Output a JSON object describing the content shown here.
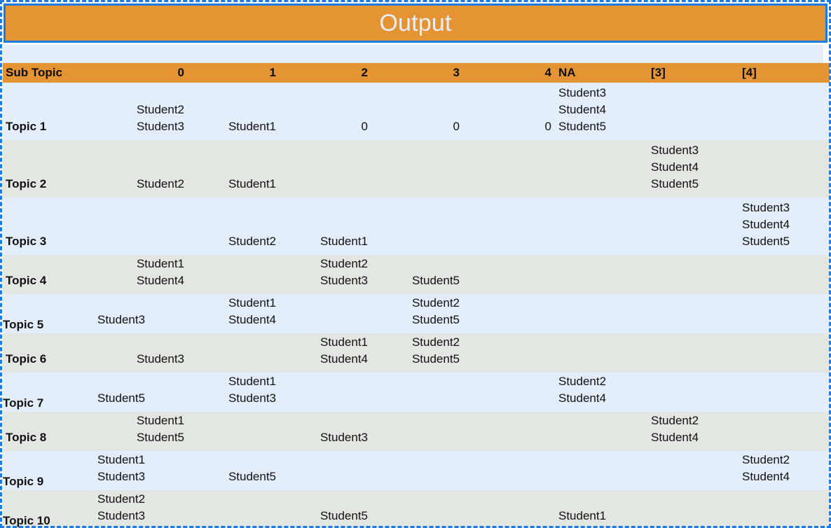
{
  "title": "Output",
  "colors": {
    "header_orange": "#e59434",
    "frame_blue": "#1b7ae4",
    "row_blue": "#e4eefa",
    "row_green": "#e3e7e1",
    "title_text": "#e8eef8"
  },
  "table": {
    "columns": [
      {
        "label": "Sub Topic",
        "align": "left",
        "key": "sub"
      },
      {
        "label": "0",
        "align": "right",
        "key": "c0"
      },
      {
        "label": "1",
        "align": "right",
        "key": "c1"
      },
      {
        "label": "2",
        "align": "right",
        "key": "c2"
      },
      {
        "label": "3",
        "align": "right",
        "key": "c3"
      },
      {
        "label": "4",
        "align": "right",
        "key": "c4"
      },
      {
        "label": "NA",
        "align": "left",
        "key": "na"
      },
      {
        "label": "[3]",
        "align": "left",
        "key": "b3"
      },
      {
        "label": "[4]",
        "align": "left",
        "key": "b4"
      }
    ],
    "rows": [
      {
        "topic": "Topic 1",
        "lines": 3,
        "cells": {
          "sub": "",
          "c0": "Student2\nStudent3",
          "c1": "Student1",
          "c2": "0",
          "c3": "0",
          "c4": "0",
          "na": "Student3\nStudent4\nStudent5",
          "b3": "",
          "b4": ""
        }
      },
      {
        "topic": "Topic 2",
        "lines": 3,
        "cells": {
          "sub": "",
          "c0": "Student2",
          "c1": "Student1",
          "c2": "",
          "c3": "",
          "c4": "",
          "na": "",
          "b3": "Student3\nStudent4\nStudent5",
          "b4": ""
        }
      },
      {
        "topic": "Topic 3",
        "lines": 3,
        "cells": {
          "sub": "",
          "c0": "",
          "c1": "Student2",
          "c2": "Student1",
          "c3": "",
          "c4": "",
          "na": "",
          "b3": "",
          "b4": "Student3\nStudent4\nStudent5"
        }
      },
      {
        "topic": "Topic 4",
        "lines": 2,
        "cells": {
          "sub": "",
          "c0": "Student1\nStudent4",
          "c1": "",
          "c2": "Student2\nStudent3",
          "c3": "Student5",
          "c4": "",
          "na": "",
          "b3": "",
          "b4": ""
        }
      },
      {
        "topic": "Topic 5",
        "lines": 2,
        "cells": {
          "sub": "Student3",
          "c0": "",
          "c1": "Student1\nStudent4",
          "c2": "",
          "c3": "Student2\nStudent5",
          "c4": "",
          "na": "",
          "b3": "",
          "b4": ""
        }
      },
      {
        "topic": "Topic 6",
        "lines": 2,
        "cells": {
          "sub": "",
          "c0": "Student3",
          "c1": "",
          "c2": "Student1\nStudent4",
          "c3": "Student2\nStudent5",
          "c4": "",
          "na": "",
          "b3": "",
          "b4": ""
        }
      },
      {
        "topic": "Topic 7",
        "lines": 2,
        "cells": {
          "sub": "Student5",
          "c0": "",
          "c1": "Student1\nStudent3",
          "c2": "",
          "c3": "",
          "c4": "",
          "na": "Student2\nStudent4",
          "b3": "",
          "b4": ""
        }
      },
      {
        "topic": "Topic 8",
        "lines": 2,
        "cells": {
          "sub": "",
          "c0": "Student1\nStudent5",
          "c1": "",
          "c2": "Student3",
          "c3": "",
          "c4": "",
          "na": "",
          "b3": "Student2\nStudent4",
          "b4": ""
        }
      },
      {
        "topic": "Topic 9",
        "lines": 2,
        "cells": {
          "sub": "Student1\nStudent3",
          "c0": "",
          "c1": "Student5",
          "c2": "",
          "c3": "",
          "c4": "",
          "na": "",
          "b3": "",
          "b4": "Student2\nStudent4"
        }
      },
      {
        "topic": "Topic 10",
        "lines": 2,
        "cells": {
          "sub": "Student2\nStudent3",
          "c0": "",
          "c1": "",
          "c2": "Student5",
          "c3": "",
          "c4": "",
          "na": "Student1",
          "b3": "",
          "b4": ""
        }
      }
    ]
  }
}
